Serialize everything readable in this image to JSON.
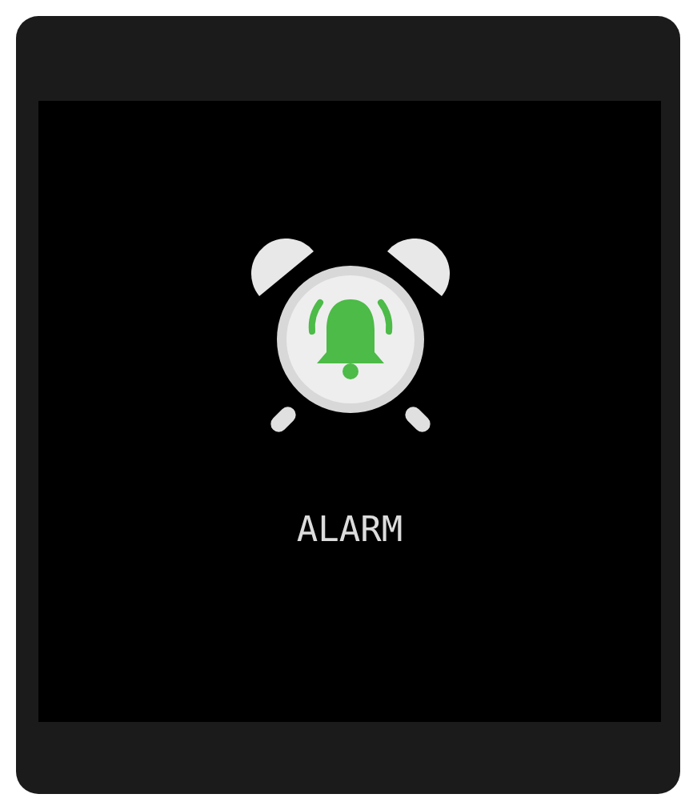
{
  "screen": {
    "label": "ALARM"
  }
}
